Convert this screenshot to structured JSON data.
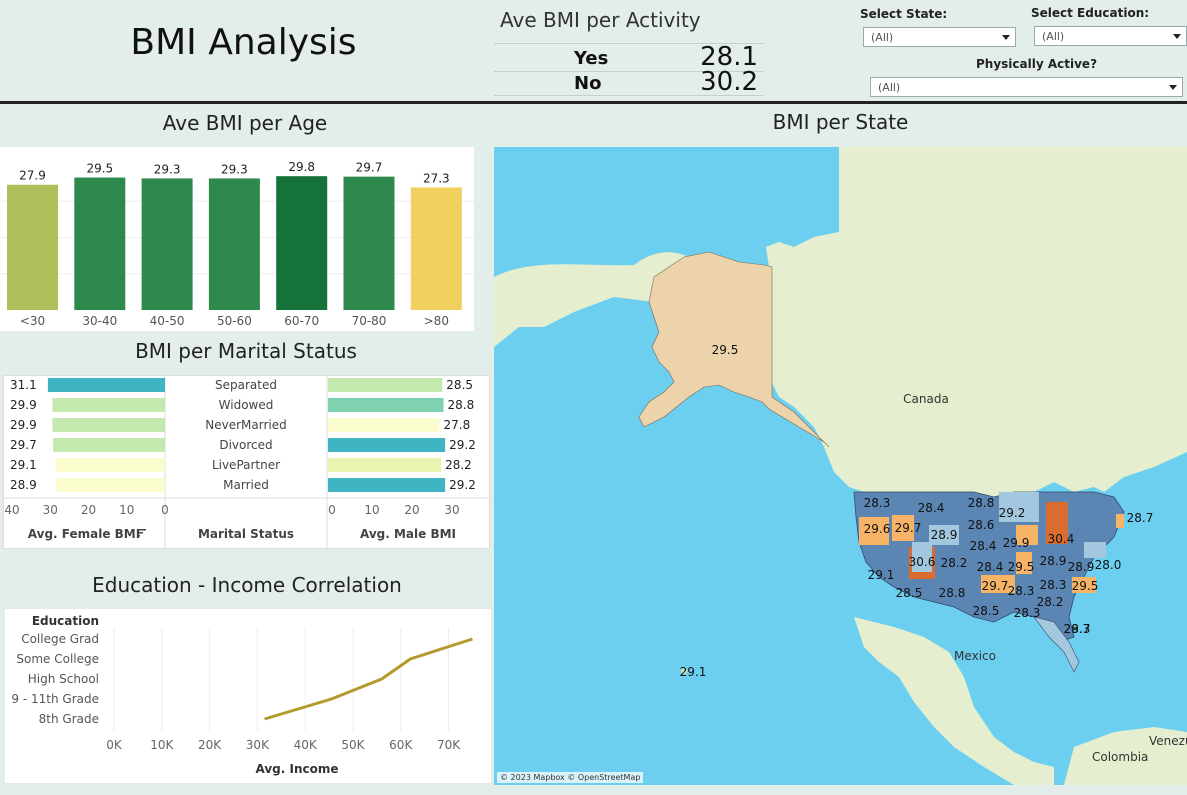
{
  "dashboard": {
    "title": "BMI Analysis"
  },
  "activity": {
    "title": "Ave BMI per Activity",
    "rows": [
      {
        "label": "Yes",
        "value": "28.1"
      },
      {
        "label": "No",
        "value": "30.2"
      }
    ]
  },
  "filters": {
    "state": {
      "label": "Select State:",
      "value": "(All)"
    },
    "education": {
      "label": "Select Education:",
      "value": "(All)"
    },
    "active": {
      "label": "Physically Active?",
      "value": "(All)"
    }
  },
  "age_section": {
    "title": "Ave BMI per Age"
  },
  "marital_section": {
    "title": "BMI per Marital Status",
    "female_axis_label": "Avg. Female BMI",
    "center_label": "Marital Status",
    "male_axis_label": "Avg. Male BMI",
    "female_ticks": [
      "40",
      "30",
      "20",
      "10",
      "0"
    ],
    "male_ticks": [
      "0",
      "10",
      "20",
      "30"
    ]
  },
  "education_section": {
    "title": "Education - Income Correlation"
  },
  "map_section": {
    "title": "BMI per State",
    "labels": {
      "canada": "Canada",
      "mexico": "Mexico",
      "venezuela": "Venezuel",
      "colombia": "Colombia"
    },
    "attribution": "© 2023 Mapbox © OpenStreetMap"
  },
  "colors": {
    "dark_green": "#157238",
    "green": "#2e8a4c",
    "light_olive": "#adc05a",
    "yellow": "#f2d060",
    "teal": "#3fb5c3",
    "light_green": "#c3e9ae",
    "pale_yellow": "#fbfccd",
    "line_gold": "#b49a2c",
    "state_blue": "#5b86b4",
    "state_light_blue": "#a3c7de",
    "state_orange": "#f7b466",
    "state_dark_orange": "#d96c2e",
    "alaska": "#edd3ab"
  },
  "chart_data": [
    {
      "type": "bar",
      "title": "Ave BMI per Age",
      "categories": [
        "<30",
        "30-40",
        "40-50",
        "50-60",
        "60-70",
        "70-80",
        ">80"
      ],
      "values": [
        27.9,
        29.5,
        29.3,
        29.3,
        29.8,
        29.7,
        27.3
      ],
      "ylim": [
        0,
        31
      ]
    },
    {
      "type": "bar",
      "title": "BMI per Marital Status",
      "categories": [
        "Separated",
        "Widowed",
        "NeverMarried",
        "Divorced",
        "LivePartner",
        "Married"
      ],
      "series": [
        {
          "name": "Avg. Female BMI",
          "values": [
            31.1,
            29.9,
            29.9,
            29.7,
            29.1,
            28.9
          ]
        },
        {
          "name": "Avg. Male BMI",
          "values": [
            28.5,
            28.8,
            27.8,
            29.2,
            28.2,
            29.2
          ]
        }
      ],
      "xlim_female": [
        0,
        40
      ],
      "xlim_male": [
        0,
        30
      ]
    },
    {
      "type": "line",
      "title": "Education - Income Correlation",
      "ylabel": "Education",
      "xlabel": "Avg. Income",
      "categories": [
        "8th Grade",
        "9 - 11th Grade",
        "High School",
        "Some College",
        "College Grad"
      ],
      "x": [
        31500,
        45500,
        56000,
        62000,
        75000
      ],
      "x_ticks": [
        "0K",
        "10K",
        "20K",
        "30K",
        "40K",
        "50K",
        "60K",
        "70K"
      ],
      "xlim": [
        0,
        77000
      ]
    },
    {
      "type": "map",
      "title": "BMI per State",
      "values": [
        "29.5",
        "29.1",
        "28.3",
        "28.4",
        "28.8",
        "29.2",
        "28.7",
        "29.6",
        "29.7",
        "28.6",
        "28.9",
        "29.9",
        "30.4",
        "28.9",
        "28.4",
        "30.6",
        "28.2",
        "28.4",
        "29.5",
        "28.9",
        "28.0",
        "29.1",
        "28.5",
        "29.7",
        "28.3",
        "29.5",
        "28.5",
        "28.3",
        "28.2",
        "28.8",
        "28.3",
        "28.7",
        "29.3"
      ]
    }
  ]
}
